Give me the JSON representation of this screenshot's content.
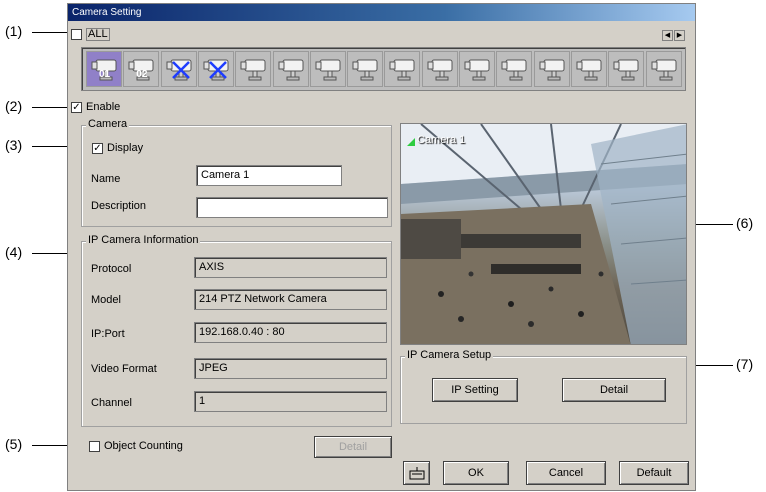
{
  "window": {
    "title": "Camera Setting"
  },
  "callouts": [
    "(1)",
    "(2)",
    "(3)",
    "(4)",
    "(5)",
    "(6)",
    "(7)"
  ],
  "all_checkbox": {
    "label": "ALL",
    "checked": false
  },
  "camera_strip": {
    "cameras": [
      {
        "number": "01",
        "state": "selected"
      },
      {
        "number": "02",
        "state": "normal"
      },
      {
        "number": "",
        "state": "disabled"
      },
      {
        "number": "",
        "state": "disabled"
      },
      {
        "number": "",
        "state": "normal"
      },
      {
        "number": "",
        "state": "normal"
      },
      {
        "number": "",
        "state": "normal"
      },
      {
        "number": "",
        "state": "normal"
      },
      {
        "number": "",
        "state": "normal"
      },
      {
        "number": "",
        "state": "normal"
      },
      {
        "number": "",
        "state": "normal"
      },
      {
        "number": "",
        "state": "normal"
      },
      {
        "number": "",
        "state": "normal"
      },
      {
        "number": "",
        "state": "normal"
      },
      {
        "number": "",
        "state": "normal"
      },
      {
        "number": "",
        "state": "normal"
      }
    ]
  },
  "enable": {
    "label": "Enable",
    "checked": true
  },
  "camera_group": {
    "title": "Camera",
    "display": {
      "label": "Display",
      "checked": true
    },
    "name_label": "Name",
    "name_value": "Camera 1",
    "description_label": "Description",
    "description_value": ""
  },
  "ipcam_info": {
    "title": "IP Camera Information",
    "protocol_label": "Protocol",
    "protocol_value": "AXIS",
    "model_label": "Model",
    "model_value": "214 PTZ Network Camera",
    "ipport_label": "IP:Port",
    "ipport_value": "192.168.0.40 : 80",
    "videoformat_label": "Video Format",
    "videoformat_value": "JPEG",
    "channel_label": "Channel",
    "channel_value": "1"
  },
  "object_counting": {
    "label": "Object Counting",
    "checked": false,
    "detail_label": "Detail"
  },
  "preview": {
    "overlay_label": "Camera 1"
  },
  "ipcam_setup": {
    "title": "IP Camera Setup",
    "ip_setting_label": "IP Setting",
    "detail_label": "Detail"
  },
  "footer": {
    "ok_label": "OK",
    "cancel_label": "Cancel",
    "default_label": "Default"
  },
  "colors": {
    "selected_cam": "#9080c8",
    "window_bg": "#d4d0c8",
    "check_green": "#2ecc40"
  }
}
